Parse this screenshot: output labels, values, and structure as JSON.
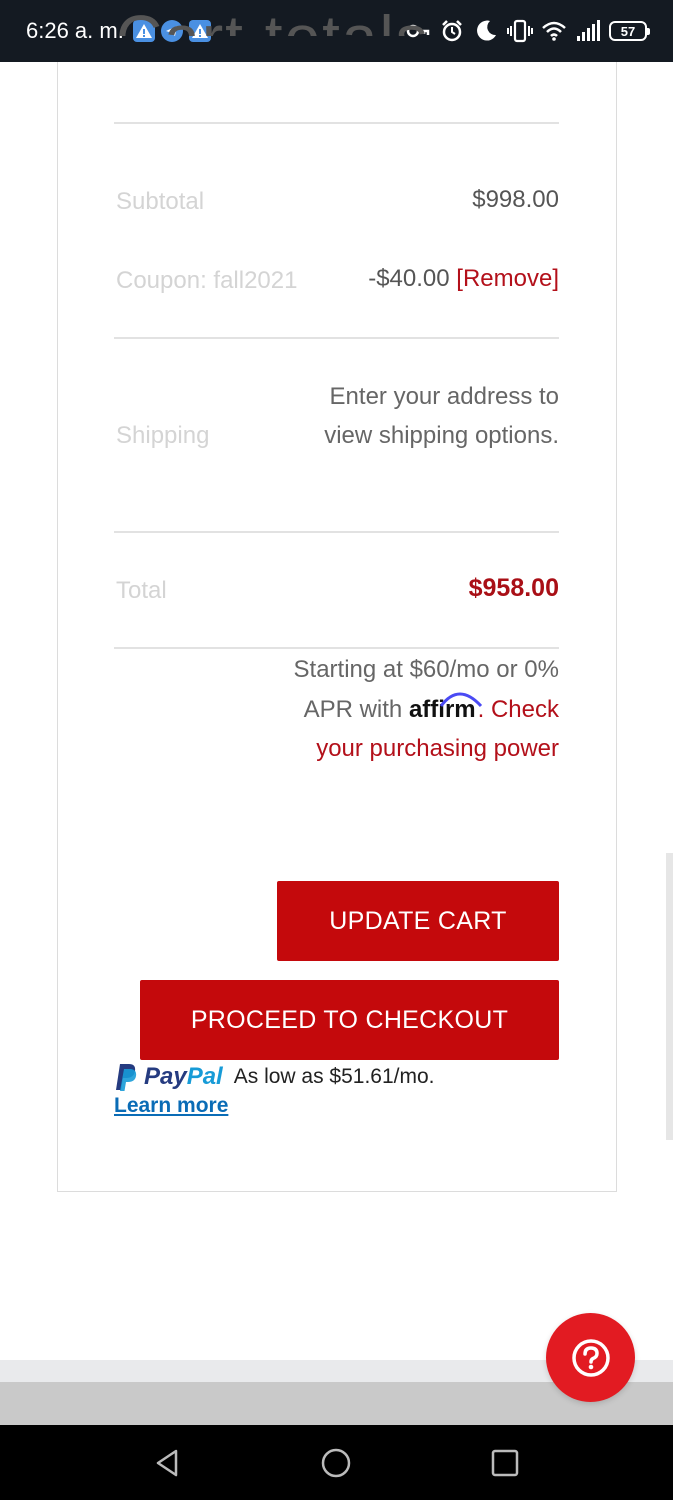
{
  "status_bar": {
    "time": "6:26 a. m.",
    "battery_level": "57",
    "notification_icons": [
      "alert-icon",
      "telegram-icon",
      "alert-icon"
    ],
    "system_icons": [
      "vpn-key-icon",
      "alarm-icon",
      "moon-icon",
      "vibrate-icon",
      "wifi-icon",
      "signal-icon",
      "battery-icon"
    ]
  },
  "cart": {
    "title": "Cart totals",
    "subtotal_label": "Subtotal",
    "subtotal_value": "$998.00",
    "coupon_label": "Coupon: fall2021",
    "coupon_value": "-$40.00",
    "coupon_remove": "[Remove]",
    "shipping_label": "Shipping",
    "shipping_text": "Enter your address to view shipping options.",
    "total_label": "Total",
    "total_value": "$958.00"
  },
  "affirm": {
    "text_before": "Starting at $60/mo or 0% APR with",
    "logo_text": "affirm",
    "link_text": "Check your purchasing power"
  },
  "buttons": {
    "update_cart": "UPDATE CART",
    "proceed_checkout": "PROCEED TO CHECKOUT"
  },
  "paypal": {
    "brand_pay": "Pay",
    "brand_pal": "Pal",
    "message": "As low as $51.61/mo.",
    "learn_more": "Learn more"
  },
  "colors": {
    "accent_red": "#c4090c",
    "price_red": "#a90f16",
    "help_button": "#e21b22",
    "paypal_blue": "#253b80",
    "paypal_light_blue": "#179bd7"
  }
}
